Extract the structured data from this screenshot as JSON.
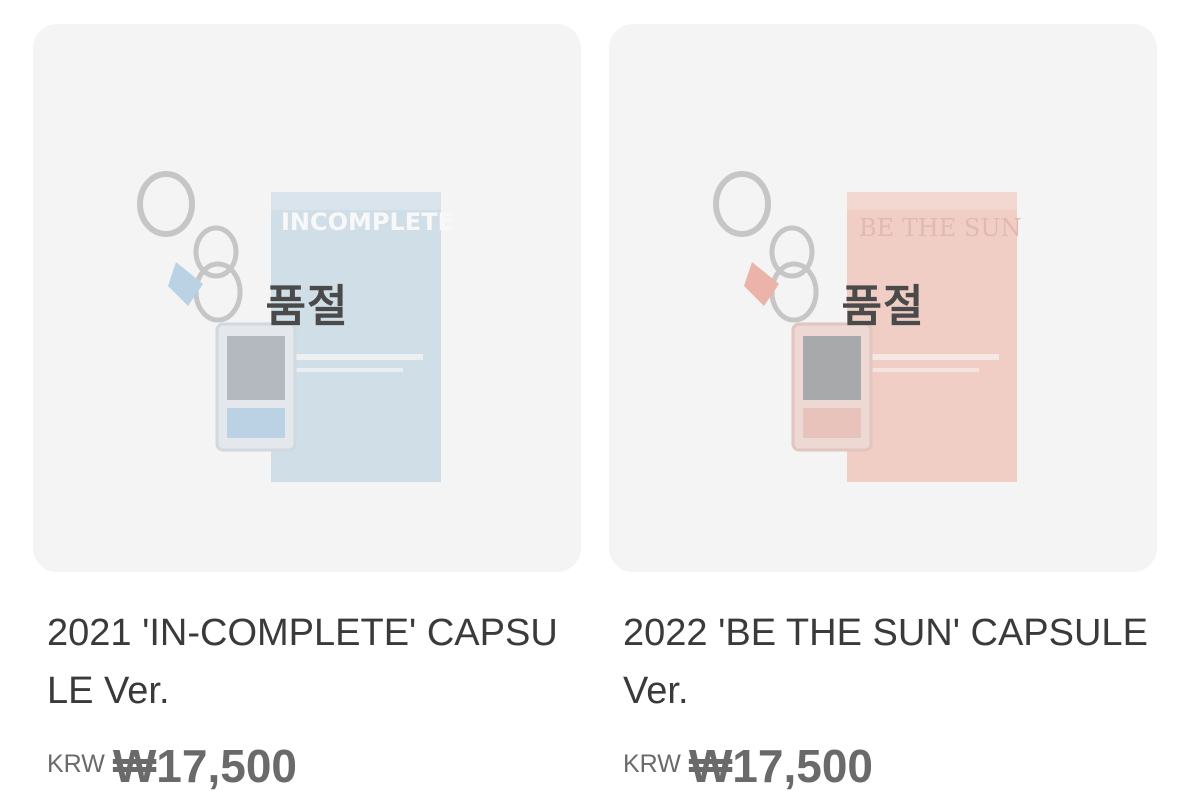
{
  "products": [
    {
      "name": "2021 'IN-COMPLETE' CAPSULE Ver.",
      "status": "품절",
      "currency": "KRW",
      "price": "₩17,500",
      "box_text": "INCOMPLETE",
      "box_color": "#9fc0d8"
    },
    {
      "name": "2022 'BE THE SUN' CAPSULE Ver.",
      "status": "품절",
      "currency": "KRW",
      "price": "₩17,500",
      "box_text": "BE THE SUN",
      "box_color": "#ee9a86"
    }
  ]
}
